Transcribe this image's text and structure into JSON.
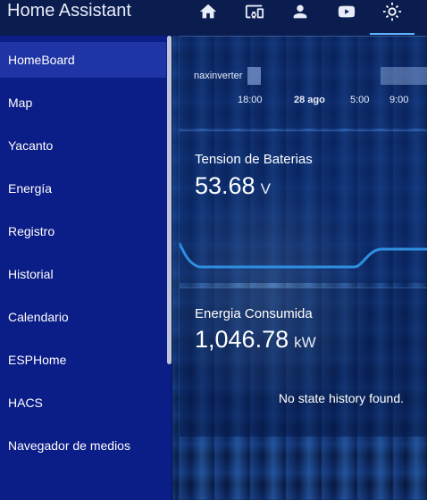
{
  "app": {
    "title": "Home Assistant"
  },
  "tabs": [
    {
      "icon": "home-icon"
    },
    {
      "icon": "devices-icon"
    },
    {
      "icon": "account-icon"
    },
    {
      "icon": "youtube-icon"
    },
    {
      "icon": "sun-icon",
      "active": true
    }
  ],
  "sidebar": {
    "items": [
      {
        "label": "HomeBoard",
        "selected": true
      },
      {
        "label": "Map"
      },
      {
        "label": "Yacanto"
      },
      {
        "label": "Energía"
      },
      {
        "label": "Registro"
      },
      {
        "label": "Historial"
      },
      {
        "label": "Calendario"
      },
      {
        "label": "ESPHome"
      },
      {
        "label": "HACS"
      },
      {
        "label": "Navegador de medios"
      }
    ]
  },
  "history_card": {
    "legend": "naxinverter",
    "ticks": [
      "18:00",
      "28 ago",
      "5:00",
      "9:00"
    ]
  },
  "battery_card": {
    "title": "Tension de Baterias",
    "value": "53.68",
    "unit": "V"
  },
  "energy_card": {
    "title": "Energia Consumida",
    "value": "1,046.78",
    "unit": "kW",
    "empty_text": "No state history found."
  },
  "colors": {
    "appbar": "#0b1c4f",
    "sidebar": "#0b1d86",
    "sidebar_selected": "#1f35a6",
    "accent": "#5fb2ff",
    "sparkline": "#2e8fe0"
  }
}
